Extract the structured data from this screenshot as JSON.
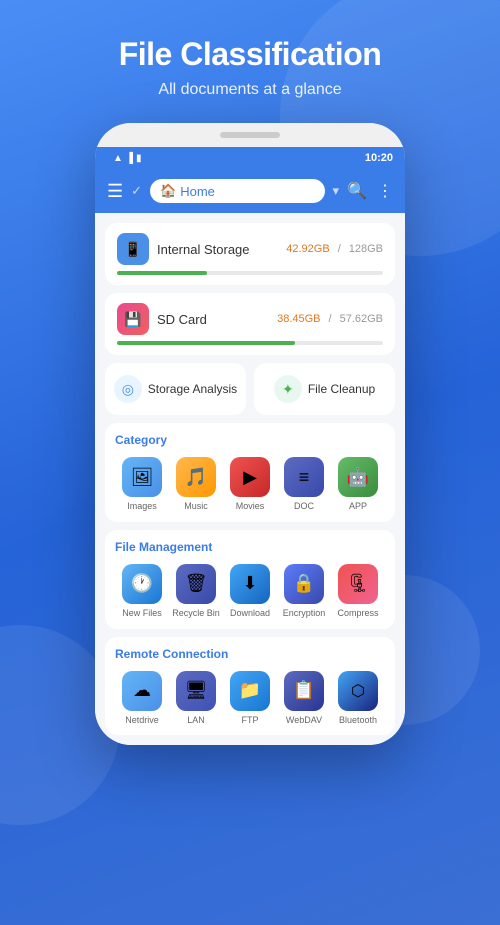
{
  "hero": {
    "title": "File Classification",
    "subtitle": "All documents at a glance"
  },
  "statusbar": {
    "time": "10:20"
  },
  "topbar": {
    "home_label": "Home"
  },
  "storage": [
    {
      "name": "Internal Storage",
      "used": "42.92GB",
      "total": "128GB",
      "percent": 34,
      "icon": "💾"
    },
    {
      "name": "SD Card",
      "used": "38.45GB",
      "total": "57.62GB",
      "percent": 67,
      "icon": "💿"
    }
  ],
  "quick_actions": [
    {
      "label": "Storage Analysis",
      "icon": "◎"
    },
    {
      "label": "File Cleanup",
      "icon": "🗂"
    }
  ],
  "category": {
    "title": "Category",
    "items": [
      {
        "label": "Images",
        "icon": "🖼"
      },
      {
        "label": "Music",
        "icon": "🎵"
      },
      {
        "label": "Movies",
        "icon": "🎬"
      },
      {
        "label": "DOC",
        "icon": "≡"
      },
      {
        "label": "APP",
        "icon": "🤖"
      }
    ]
  },
  "file_management": {
    "title": "File Management",
    "items": [
      {
        "label": "New Files",
        "icon": "🕐"
      },
      {
        "label": "Recycle Bin",
        "icon": "🗑"
      },
      {
        "label": "Download",
        "icon": "⬇"
      },
      {
        "label": "Encryption",
        "icon": "🔒"
      },
      {
        "label": "Compress",
        "icon": "🗜"
      }
    ]
  },
  "remote": {
    "title": "Remote Connection",
    "items": [
      {
        "label": "Netdrive",
        "icon": "☁"
      },
      {
        "label": "LAN",
        "icon": "🖥"
      },
      {
        "label": "FTP",
        "icon": "📁"
      },
      {
        "label": "WebDAV",
        "icon": "📋"
      },
      {
        "label": "Bluetooth",
        "icon": "🔵"
      }
    ]
  }
}
